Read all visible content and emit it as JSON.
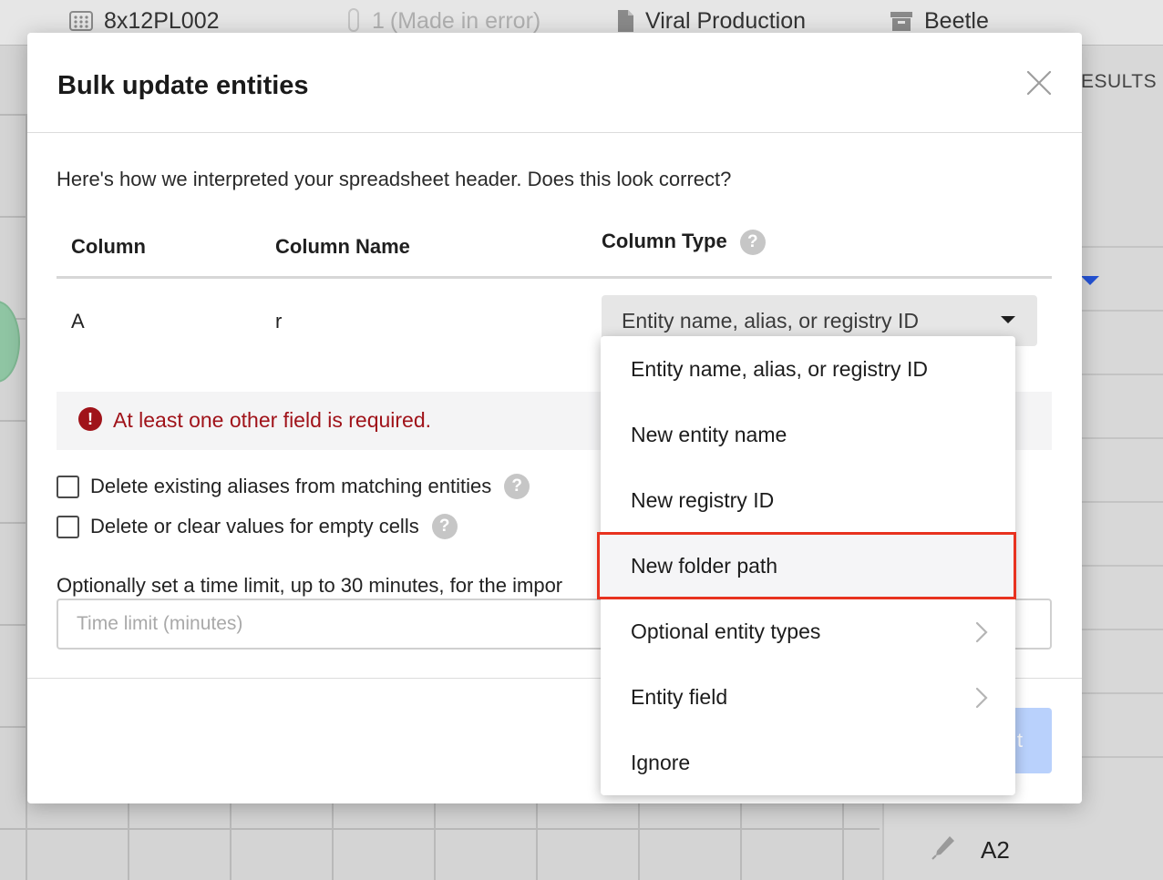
{
  "background": {
    "breadcrumbs": [
      {
        "label": "8x12PL002"
      },
      {
        "label": "1",
        "muted": "(Made in error)"
      },
      {
        "label": "Viral Production"
      },
      {
        "label": "Beetle"
      }
    ],
    "results_label": "ESULTS",
    "well_label": "A2"
  },
  "modal": {
    "title": "Bulk update entities",
    "intro": "Here's how we interpreted your spreadsheet header. Does this look correct?",
    "table": {
      "headers": {
        "column": "Column",
        "column_name": "Column Name",
        "column_type": "Column Type"
      },
      "row": {
        "column": "A",
        "column_name": "r",
        "column_type": "Entity name, alias, or registry ID"
      }
    },
    "error": "At least one other field is required.",
    "options": {
      "delete_aliases": "Delete existing aliases from matching entities",
      "clear_empty": "Delete or clear values for empty cells"
    },
    "time_limit": {
      "label": "Optionally set a time limit, up to 30 minutes, for the impor",
      "placeholder": "Time limit (minutes)"
    },
    "submit_label": "t"
  },
  "dropdown": {
    "items": [
      {
        "label": "Entity name, alias, or registry ID"
      },
      {
        "label": "New entity name"
      },
      {
        "label": "New registry ID"
      },
      {
        "label": "New folder path",
        "highlighted": true
      },
      {
        "label": "Optional entity types",
        "submenu": true
      },
      {
        "label": "Entity field",
        "submenu": true
      },
      {
        "label": "Ignore"
      }
    ]
  },
  "colors": {
    "error": "#a0131a",
    "highlight_outline": "#e8321f",
    "submit_disabled": "#b9d1fc",
    "accent_caret": "#2453d6"
  }
}
